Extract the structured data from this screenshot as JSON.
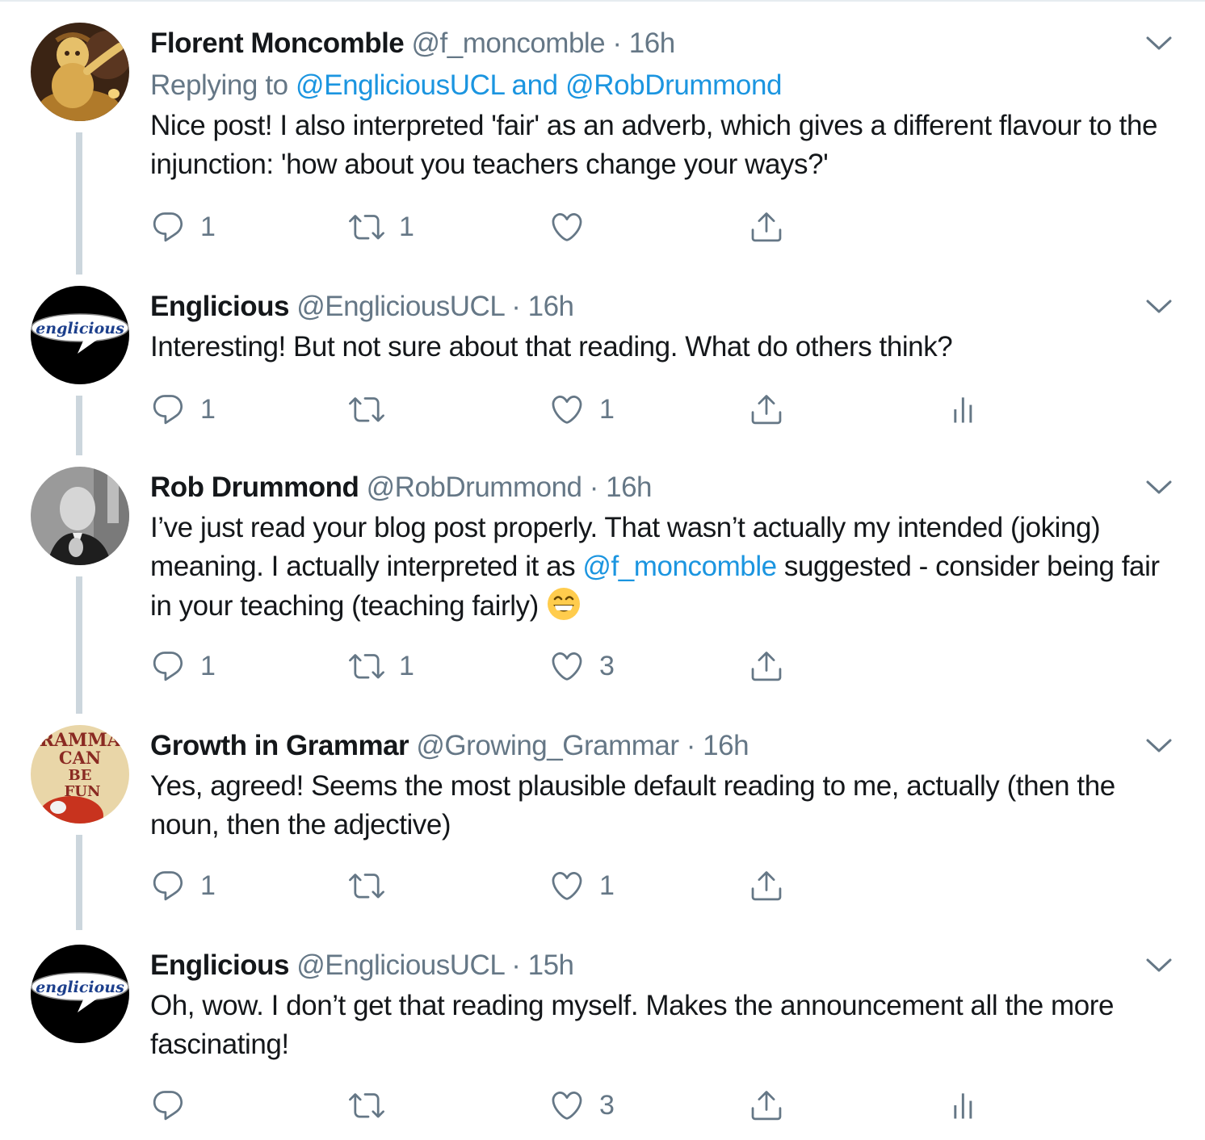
{
  "colors": {
    "link": "#1b95e0",
    "secondary": "#657786",
    "text": "#14171a",
    "thread": "#ccd6dd"
  },
  "tweets": [
    {
      "name": "Florent Moncomble",
      "handle": "@f_moncomble",
      "dot": "·",
      "time": "16h",
      "reply_prefix": "Replying to",
      "reply_user1": "@EngliciousUCL",
      "reply_and": "and",
      "reply_user2": "@RobDrummond",
      "text": "Nice post! I also interpreted 'fair' as an adverb, which gives a different flavour to the injunction: 'how about you teachers change your ways?'",
      "replies": "1",
      "retweets": "1",
      "likes": ""
    },
    {
      "name": "Englicious",
      "handle": "@EngliciousUCL",
      "dot": "·",
      "time": "16h",
      "avatar_text": "englicious",
      "text": "Interesting! But not sure about that reading. What do others think?",
      "replies": "1",
      "retweets": "",
      "likes": "1"
    },
    {
      "name": "Rob Drummond",
      "handle": "@RobDrummond",
      "dot": "·",
      "time": "16h",
      "text_part1": "I’ve just read your blog post properly. That wasn’t actually my intended (joking) meaning. I actually interpreted it as ",
      "mention": "@f_moncomble",
      "text_part2": " suggested - consider being fair in your teaching (teaching fairly) ",
      "emoji": "grinning-face-emoji",
      "replies": "1",
      "retweets": "1",
      "likes": "3"
    },
    {
      "name": "Growth in Grammar",
      "handle": "@Growing_Grammar",
      "dot": "·",
      "time": "16h",
      "avatar_lines": [
        "GRAMMAR",
        "CAN",
        "BE",
        "FUN"
      ],
      "text": "Yes, agreed! Seems the most plausible default reading to me, actually (then the noun, then the adjective)",
      "replies": "1",
      "retweets": "",
      "likes": "1"
    },
    {
      "name": "Englicious",
      "handle": "@EngliciousUCL",
      "dot": "·",
      "time": "15h",
      "avatar_text": "englicious",
      "text": "Oh, wow. I don’t get that reading myself. Makes the announcement all the more fascinating!",
      "replies": "",
      "retweets": "",
      "likes": "3"
    }
  ],
  "icons": [
    "reply-icon",
    "retweet-icon",
    "like-icon",
    "share-icon",
    "analytics-icon",
    "caret-down-icon"
  ]
}
